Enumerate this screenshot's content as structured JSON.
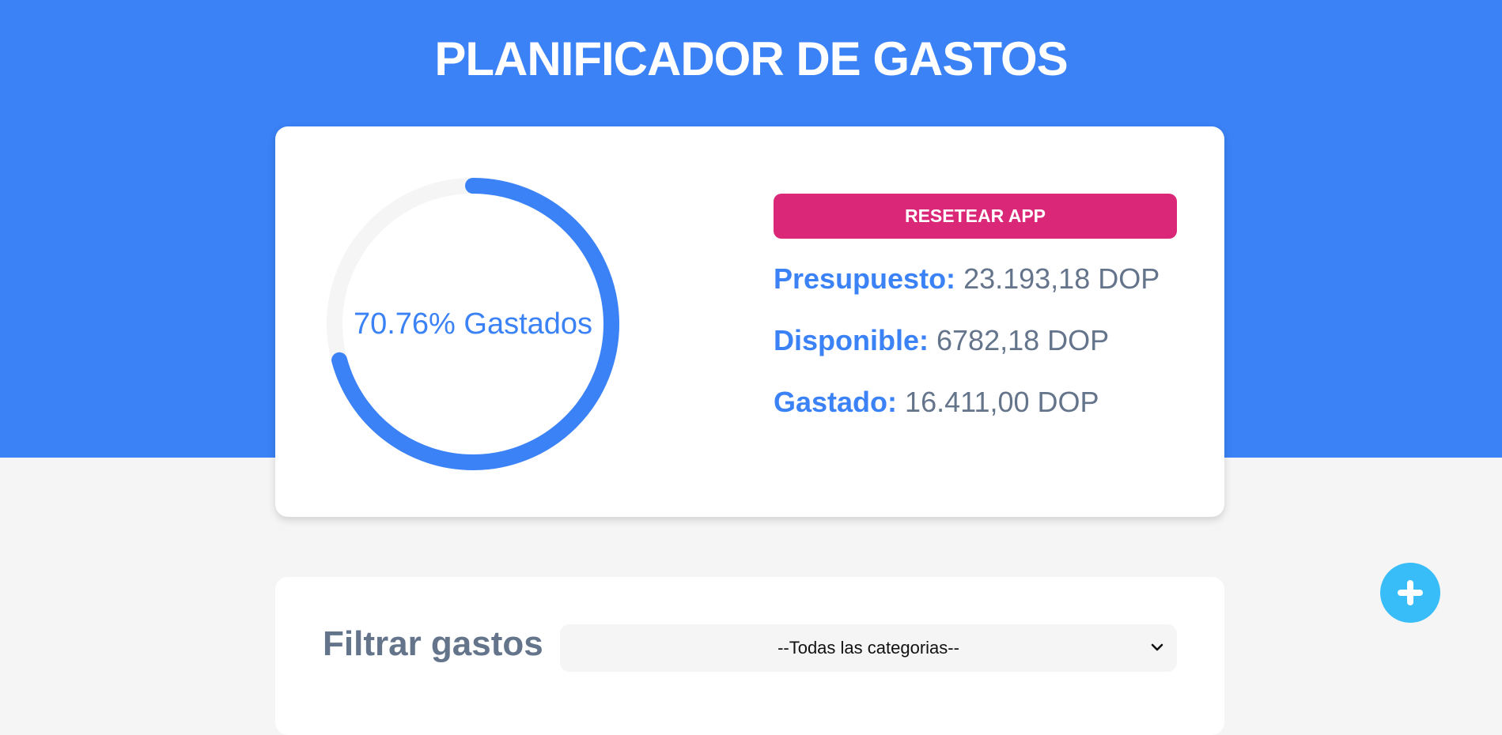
{
  "header": {
    "title": "PLANIFICADOR DE GASTOS"
  },
  "budget": {
    "progress_percent": 70.76,
    "progress_label": "70.76% Gastados",
    "reset_label": "RESETEAR APP",
    "stats": [
      {
        "label": "Presupuesto:",
        "value": "23.193,18 DOP"
      },
      {
        "label": "Disponible:",
        "value": "6782,18 DOP"
      },
      {
        "label": "Gastado:",
        "value": "16.411,00 DOP"
      }
    ]
  },
  "filter": {
    "title": "Filtrar gastos",
    "selected": "--Todas las categorias--"
  },
  "icons": {
    "add": "plus-icon",
    "select": "chevron-down-icon"
  },
  "colors": {
    "primary": "#3b82f6",
    "reset": "#db2777",
    "add": "#38bdf8",
    "track": "#f5f5f5",
    "muted_text": "#64748b"
  }
}
